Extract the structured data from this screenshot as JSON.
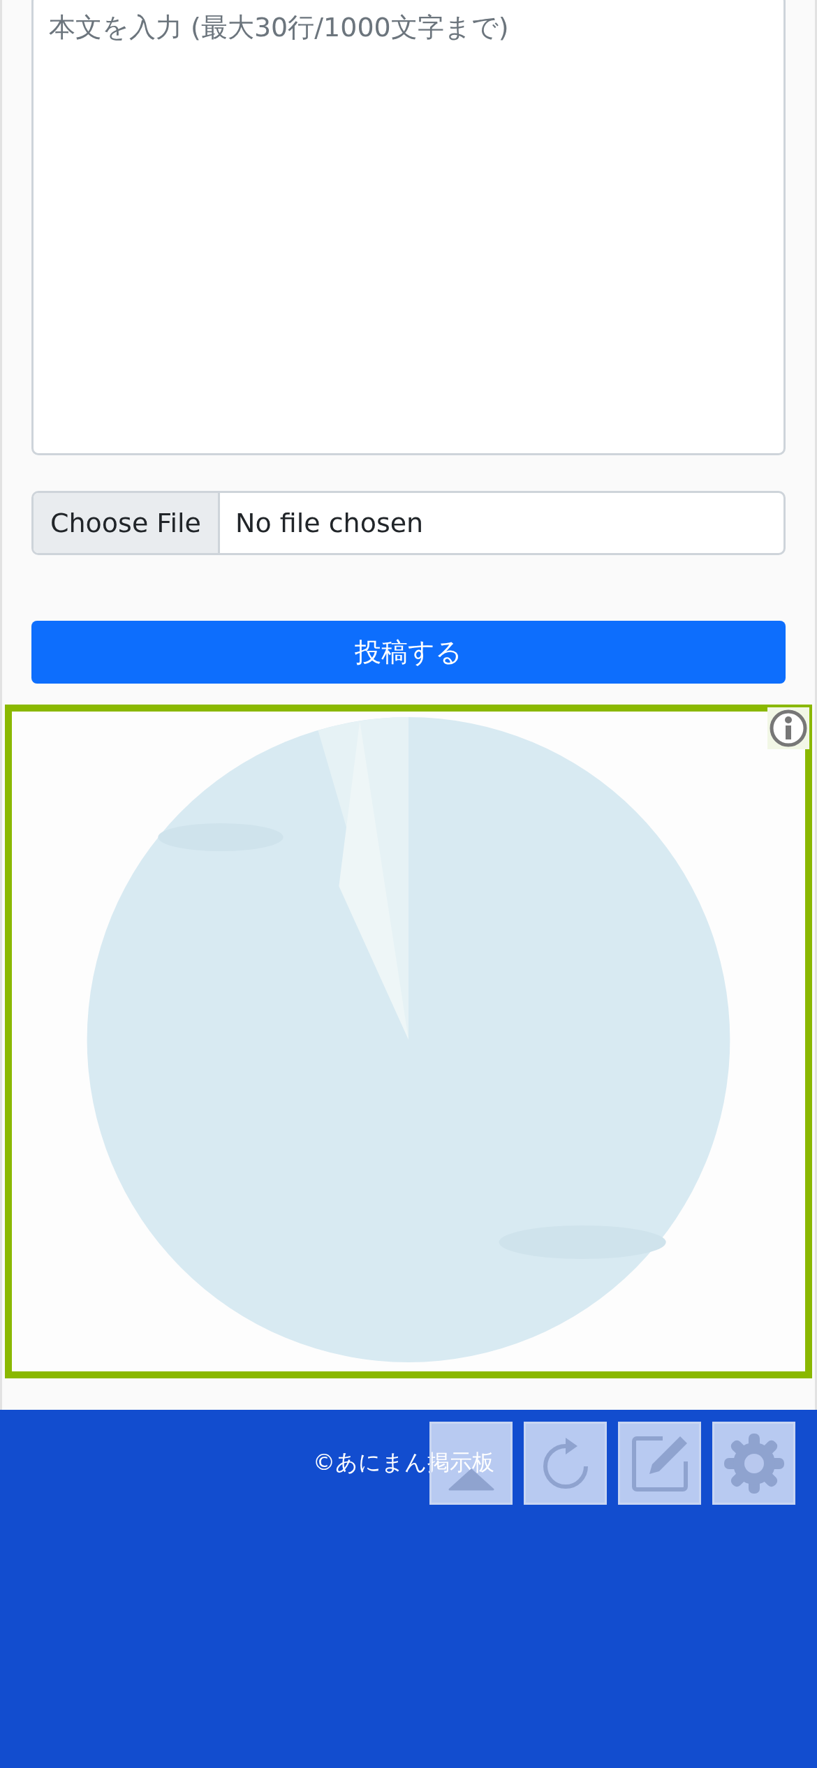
{
  "form": {
    "body": {
      "placeholder": "本文を入力 (最大30行/1000文字まで)"
    },
    "file": {
      "button": "Choose File",
      "status": "No file chosen"
    },
    "submit": "投稿する"
  },
  "footer": {
    "copyright": "©あにまん掲示板"
  },
  "floating_buttons": [
    {
      "kind": "top"
    },
    {
      "kind": "reload"
    },
    {
      "kind": "edit"
    },
    {
      "kind": "settings"
    }
  ]
}
